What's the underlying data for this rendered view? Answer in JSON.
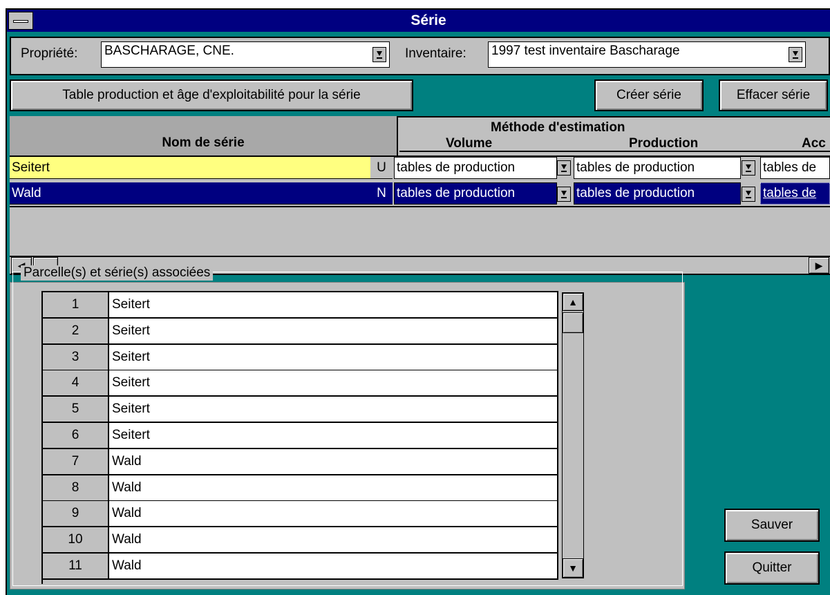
{
  "window": {
    "title": "Série"
  },
  "top": {
    "propriete_label": "Propriété:",
    "propriete_value": "BASCHARAGE, CNE.",
    "inventaire_label": "Inventaire:",
    "inventaire_value": "1997 test inventaire Bascharage"
  },
  "buttons": {
    "table_production": "Table production et âge d'exploitabilité pour la série",
    "creer": "Créer série",
    "effacer": "Effacer série",
    "sauver": "Sauver",
    "quitter": "Quitter"
  },
  "grid": {
    "col_nom": "Nom de série",
    "group_header": "Méthode d'estimation",
    "col_volume": "Volume",
    "col_production": "Production",
    "col_acc": "Acc",
    "rows": [
      {
        "nom": "Seitert",
        "flag": "U",
        "volume": "tables de production",
        "production": "tables de production",
        "acc": "tables de",
        "selected": false
      },
      {
        "nom": "Wald",
        "flag": "N",
        "volume": "tables de production",
        "production": "tables de production",
        "acc": "tables de",
        "selected": true
      }
    ]
  },
  "parcelles": {
    "legend": "Parcelle(s) et série(s) associées",
    "rows": [
      {
        "num": "1",
        "serie": "Seitert"
      },
      {
        "num": "2",
        "serie": "Seitert"
      },
      {
        "num": "3",
        "serie": "Seitert"
      },
      {
        "num": "4",
        "serie": "Seitert"
      },
      {
        "num": "5",
        "serie": "Seitert"
      },
      {
        "num": "6",
        "serie": "Seitert"
      },
      {
        "num": "7",
        "serie": "Wald"
      },
      {
        "num": "8",
        "serie": "Wald"
      },
      {
        "num": "9",
        "serie": "Wald"
      },
      {
        "num": "10",
        "serie": "Wald"
      },
      {
        "num": "11",
        "serie": "Wald"
      }
    ]
  },
  "colors": {
    "titlebar": "#000080",
    "background": "#008080",
    "face": "#c0c0c0",
    "highlight_row": "#ffff80"
  }
}
